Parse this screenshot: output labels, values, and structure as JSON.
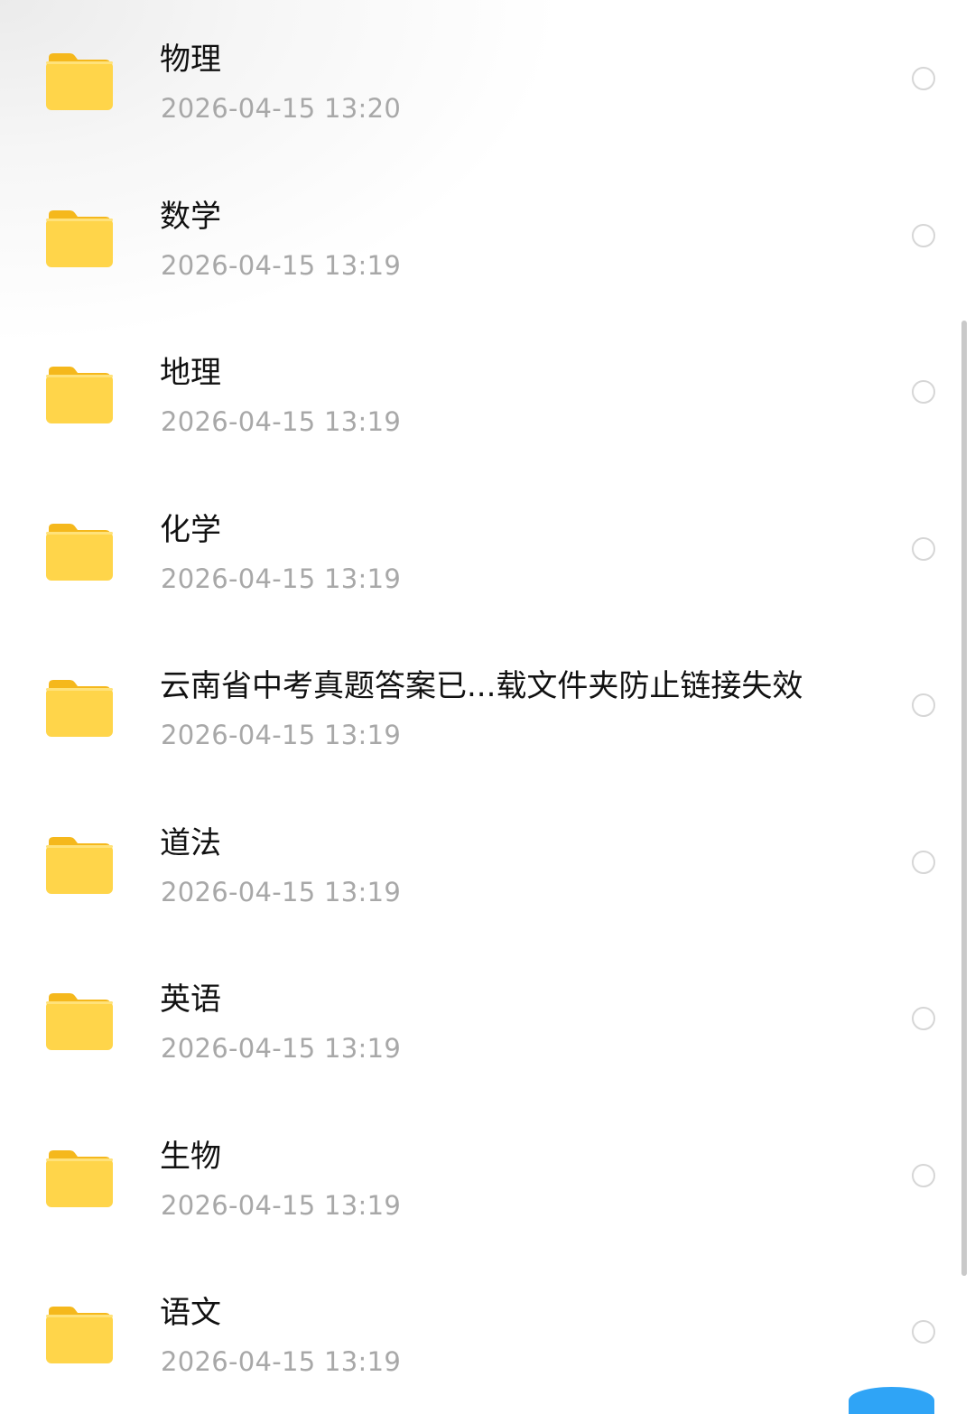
{
  "folders": [
    {
      "name": "物理",
      "time": "2026-04-15 13:20",
      "icon": "folder-icon"
    },
    {
      "name": "数学",
      "time": "2026-04-15 13:19",
      "icon": "folder-icon"
    },
    {
      "name": "地理",
      "time": "2026-04-15 13:19",
      "icon": "folder-icon"
    },
    {
      "name": "化学",
      "time": "2026-04-15 13:19",
      "icon": "folder-icon"
    },
    {
      "name": "云南省中考真题答案已...载文件夹防止链接失效",
      "time": "2026-04-15 13:19",
      "icon": "folder-icon"
    },
    {
      "name": "道法",
      "time": "2026-04-15 13:19",
      "icon": "folder-icon"
    },
    {
      "name": "英语",
      "time": "2026-04-15 13:19",
      "icon": "folder-icon"
    },
    {
      "name": "生物",
      "time": "2026-04-15 13:19",
      "icon": "folder-icon"
    },
    {
      "name": "语文",
      "time": "2026-04-15 13:19",
      "icon": "folder-icon"
    }
  ],
  "colors": {
    "folder_front": "#FFD54A",
    "folder_back": "#F5B81C",
    "name_text": "#111111",
    "time_text": "#A8A8A8",
    "radio_border": "#D6D6D6",
    "accent": "#2FA4F6"
  }
}
